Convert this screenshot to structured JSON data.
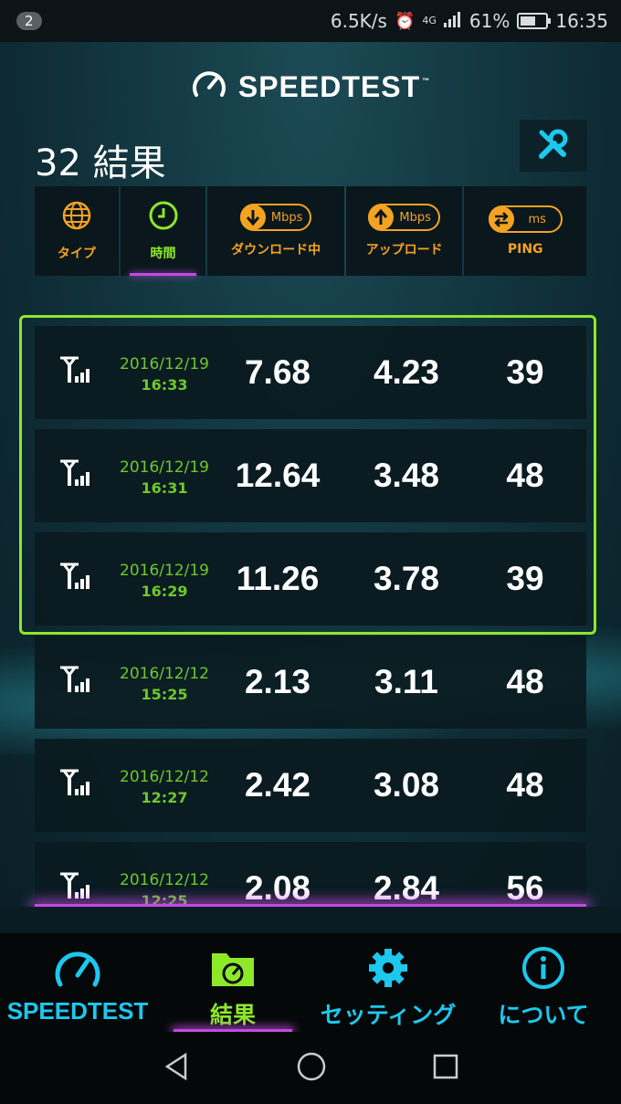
{
  "status_bar": {
    "notification_count": "2",
    "net_speed": "6.5K/s",
    "network": "4G",
    "battery": "61%",
    "clock": "16:35"
  },
  "app": {
    "logo_text": "SPEEDTEST",
    "logo_tm": "™",
    "results_title": "32 結果"
  },
  "columns": [
    {
      "label": "タイプ",
      "icon": "globe-icon"
    },
    {
      "label": "時間",
      "icon": "clock-icon"
    },
    {
      "label": "ダウンロード中",
      "icon": "download-arrow-icon",
      "unit": "Mbps"
    },
    {
      "label": "アップロード",
      "icon": "upload-arrow-icon",
      "unit": "Mbps"
    },
    {
      "label": "PING",
      "icon": "swap-arrows-icon",
      "unit": "ms"
    }
  ],
  "results": [
    {
      "date": "2016/12/19",
      "time": "16:33",
      "download": "7.68",
      "upload": "4.23",
      "ping": "39"
    },
    {
      "date": "2016/12/19",
      "time": "16:31",
      "download": "12.64",
      "upload": "3.48",
      "ping": "48"
    },
    {
      "date": "2016/12/19",
      "time": "16:29",
      "download": "11.26",
      "upload": "3.78",
      "ping": "39"
    },
    {
      "date": "2016/12/12",
      "time": "15:25",
      "download": "2.13",
      "upload": "3.11",
      "ping": "48"
    },
    {
      "date": "2016/12/12",
      "time": "12:27",
      "download": "2.42",
      "upload": "3.08",
      "ping": "48"
    },
    {
      "date": "2016/12/12",
      "time": "12:25",
      "download": "2.08",
      "upload": "2.84",
      "ping": "56"
    }
  ],
  "nav": {
    "speedtest": "SPEEDTEST",
    "results": "結果",
    "settings": "セッティング",
    "about": "について"
  },
  "colors": {
    "accent_green": "#8ee82a",
    "accent_orange": "#f4a321",
    "accent_cyan": "#1dc8ee",
    "accent_purple": "#c24be0"
  }
}
